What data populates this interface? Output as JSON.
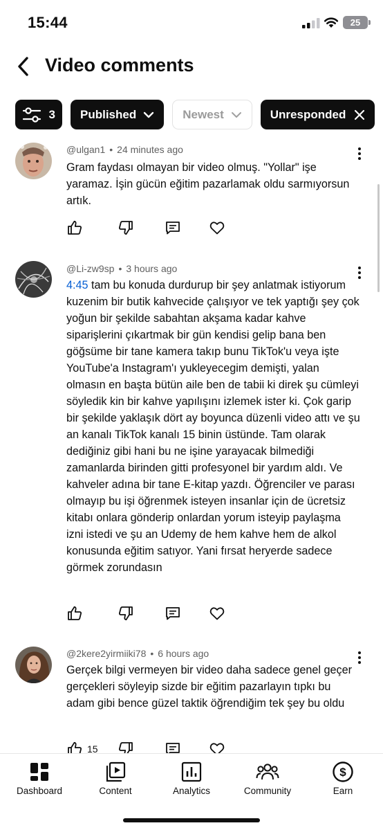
{
  "status_bar": {
    "time": "15:44",
    "battery": "25"
  },
  "header": {
    "title": "Video comments"
  },
  "filters": {
    "filter_count": "3",
    "published_label": "Published",
    "sort_label": "Newest",
    "status_label": "Unresponded"
  },
  "comments": [
    {
      "author": "@ulgan1",
      "time": "24 minutes ago",
      "timestamp_link": "",
      "text": "Gram faydası olmayan bir video olmuş. \"Yollar\" işe yaramaz. İşin gücün eğitim pazarlamak oldu sarmıyorsun artık.",
      "likes": ""
    },
    {
      "author": "@Li-zw9sp",
      "time": "3 hours ago",
      "timestamp_link": "4:45",
      "text": " tam bu konuda durdurup bir şey anlatmak istiyorum kuzenim bir butik kahvecide çalışıyor ve tek yaptığı şey çok yoğun bir şekilde sabahtan akşama kadar kahve siparişlerini çıkartmak bir gün kendisi gelip bana ben göğsüme bir tane kamera takıp bunu TikTok'u veya işte YouTube'a Instagram'ı yukleyecegim demişti, yalan olmasın en başta bütün aile ben de tabii ki direk şu cümleyi söyledik kin bir kahve yapılışını izlemek ister ki. Çok garip bir şekilde yaklaşık dört ay boyunca düzenli video attı ve şu an kanalı TikTok kanalı 15 binin üstünde. Tam olarak dediğiniz gibi hani bu ne işine yarayacak bilmediği zamanlarda birinden gitti profesyonel bir yardım aldı. Ve kahveler adına bir tane E-kitap yazdı. Öğrenciler ve parası olmayıp bu işi öğrenmek isteyen insanlar için de ücretsiz kitabı onlara gönderip onlardan yorum isteyip paylaşma izni istedi ve şu an Udemy de hem kahve hem de alkol konusunda eğitim satıyor. Yani fırsat heryerde sadece görmek zorundasın",
      "likes": ""
    },
    {
      "author": "@2kere2yirmiiki78",
      "time": "6 hours ago",
      "timestamp_link": "",
      "text": "Gerçek bilgi vermeyen bir video daha sadece genel geçer gerçekleri söyleyip sizde bir eğitim pazarlayın tıpkı bu adam gibi bence güzel taktik öğrendiğim tek şey bu oldu",
      "likes": "15"
    }
  ],
  "bottom_nav": [
    {
      "label": "Dashboard",
      "icon": "dashboard-icon"
    },
    {
      "label": "Content",
      "icon": "content-icon"
    },
    {
      "label": "Analytics",
      "icon": "analytics-icon"
    },
    {
      "label": "Community",
      "icon": "community-icon"
    },
    {
      "label": "Earn",
      "icon": "earn-icon"
    }
  ]
}
